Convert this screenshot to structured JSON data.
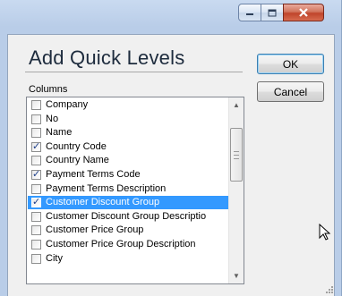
{
  "window": {
    "title": "Add Quick Levels",
    "caption_buttons": {
      "minimize_icon": "minimize-icon",
      "maximize_icon": "maximize-icon",
      "close_icon": "close-icon"
    }
  },
  "buttons": {
    "ok_label": "OK",
    "cancel_label": "Cancel"
  },
  "columns": {
    "label": "Columns",
    "items": [
      {
        "label": "Company",
        "checked": false,
        "selected": false
      },
      {
        "label": "No",
        "checked": false,
        "selected": false
      },
      {
        "label": "Name",
        "checked": false,
        "selected": false
      },
      {
        "label": "Country Code",
        "checked": true,
        "selected": false
      },
      {
        "label": "Country Name",
        "checked": false,
        "selected": false
      },
      {
        "label": "Payment Terms Code",
        "checked": true,
        "selected": false
      },
      {
        "label": "Payment Terms Description",
        "checked": false,
        "selected": false
      },
      {
        "label": "Customer Discount Group",
        "checked": true,
        "selected": true
      },
      {
        "label": "Customer Discount Group Descriptio",
        "checked": false,
        "selected": false
      },
      {
        "label": "Customer Price Group",
        "checked": false,
        "selected": false
      },
      {
        "label": "Customer Price Group Description",
        "checked": false,
        "selected": false
      },
      {
        "label": "City",
        "checked": false,
        "selected": false
      }
    ]
  },
  "colors": {
    "selection": "#3399ff",
    "check": "#1e3f8a",
    "close_red": "#c0452b"
  }
}
